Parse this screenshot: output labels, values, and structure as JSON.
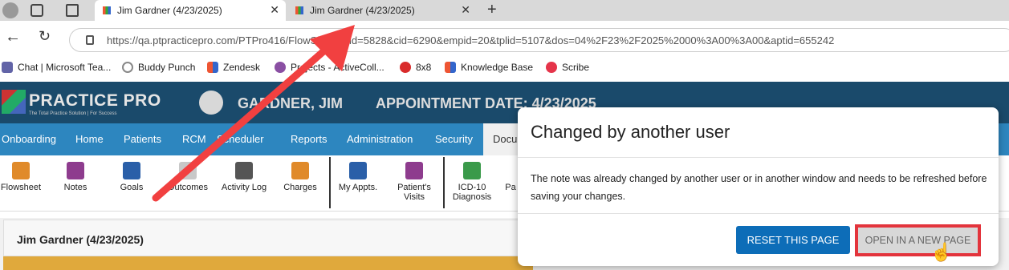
{
  "browser": {
    "tabs": [
      {
        "title": "Jim Gardner (4/23/2025)"
      },
      {
        "title": "Jim Gardner (4/23/2025)"
      }
    ],
    "url": "https://qa.ptpracticepro.com/PTPro416/FlowSheet?pid=5828&cid=6290&empid=20&tplid=5107&dos=04%2F23%2F2025%2000%3A00%3A00&aptid=655242",
    "bookmarks": [
      {
        "label": "Chat | Microsoft Tea..."
      },
      {
        "label": "Buddy Punch"
      },
      {
        "label": "Zendesk"
      },
      {
        "label": "Projects - ActiveColl..."
      },
      {
        "label": "8x8"
      },
      {
        "label": "Knowledge Base"
      },
      {
        "label": "Scribe"
      }
    ]
  },
  "app": {
    "logo": "PRACTICE PRO",
    "logo_tagline": "The Total Practice Solution | For Success",
    "patient_name": "GARDNER, JIM",
    "appointment": "APPOINTMENT DATE: 4/23/2025",
    "nav": [
      "Onboarding",
      "Home",
      "Patients",
      "RCM",
      "Scheduler",
      "Reports",
      "Administration",
      "Security",
      "Docu"
    ],
    "toolbar": [
      {
        "label": "Flowsheet"
      },
      {
        "label": "Notes"
      },
      {
        "label": "Goals"
      },
      {
        "label": "Outcomes"
      },
      {
        "label": "Activity Log"
      },
      {
        "label": "Charges"
      },
      {
        "label": "My Appts."
      },
      {
        "label": "Patient's Visits"
      },
      {
        "label": "ICD-10 Diagnosis"
      },
      {
        "label": "Pa"
      }
    ],
    "patient_header": "Jim Gardner (4/23/2025)"
  },
  "modal": {
    "title": "Changed by another user",
    "message": "The note was already changed by another user or in another window and needs to be refreshed before saving your changes.",
    "reset_label": "RESET THIS PAGE",
    "open_label": "OPEN IN A NEW PAGE"
  },
  "colors": {
    "header": "#1a4a6b",
    "nav": "#2d86bf",
    "primary_button": "#0d6db8",
    "highlight": "#e3343c"
  }
}
